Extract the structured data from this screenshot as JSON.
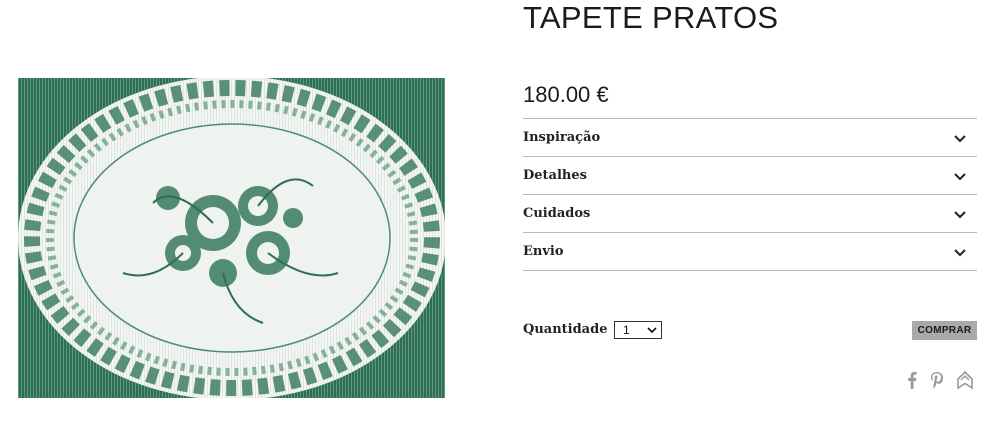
{
  "product": {
    "title": "TAPETE PRATOS",
    "price": "180.00 €",
    "image_alt": "green and white floral plate placemat"
  },
  "accordion": [
    {
      "label": "Inspiração",
      "icon": "chevron-down-icon"
    },
    {
      "label": "Detalhes",
      "icon": "chevron-down-icon"
    },
    {
      "label": "Cuidados",
      "icon": "chevron-down-icon"
    },
    {
      "label": "Envio",
      "icon": "chevron-down-icon"
    }
  ],
  "purchase": {
    "quantity_label": "Quantidade",
    "quantity_value": "1",
    "buy_label": "COMPRAR"
  },
  "share": [
    "facebook-icon",
    "pinterest-icon",
    "bookmark-icon"
  ],
  "colors": {
    "plate_green": "#2f6e55",
    "buy_button": "#a9a9a9",
    "divider": "#b8b8b8"
  }
}
